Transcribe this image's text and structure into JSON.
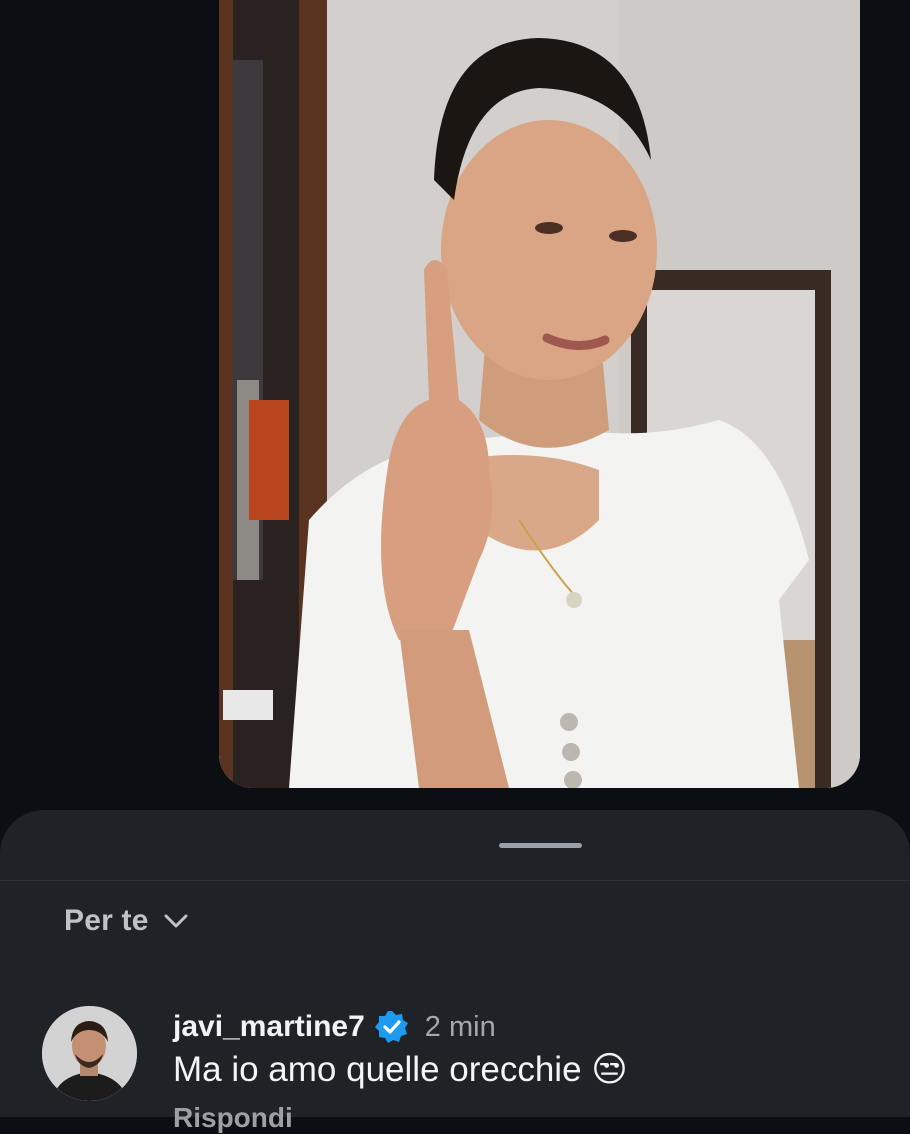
{
  "video": {
    "icon": "video-thumbnail"
  },
  "sheet": {
    "filter": {
      "label": "Per te",
      "icon": "chevron-down-icon"
    }
  },
  "comment": {
    "username": "javi_martine7",
    "verified": true,
    "timestamp": "2 min",
    "text": "Ma io amo quelle orecchie 😒",
    "reply_label": "Rispondi"
  },
  "colors": {
    "background": "#0b0f14",
    "sheet": "#1f2227",
    "verified_badge": "#1d9bf0",
    "muted_text": "#a3a8af"
  }
}
